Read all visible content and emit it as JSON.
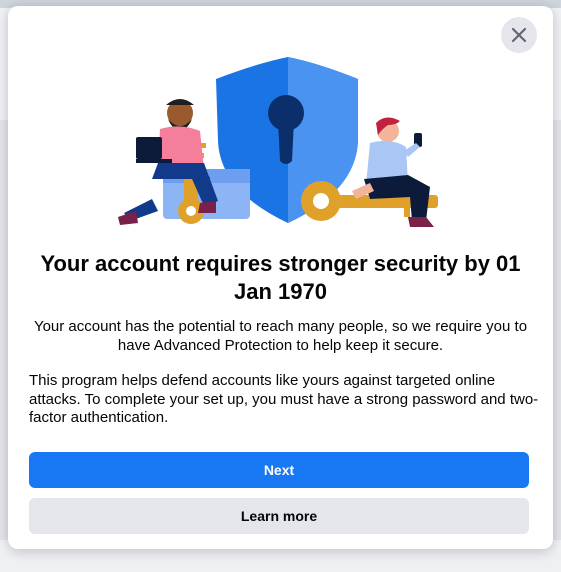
{
  "dialog": {
    "title": "Your account requires stronger security by 01 Jan 1970",
    "subtitle": "Your account has the potential to reach many people, so we require you to have Advanced Protection to help keep it secure.",
    "body": "This program helps defend accounts like yours against targeted online attacks. To complete your set up, you must have a strong password and two-factor authentication.",
    "primary_button": "Next",
    "secondary_button": "Learn more",
    "close_icon": "close-icon",
    "illustration": "shield-keyhole-with-people-and-keys"
  },
  "colors": {
    "primary": "#1877f2",
    "secondary_bg": "#e4e6eb",
    "text": "#050505",
    "shield": "#1b74e4",
    "key": "#e0a12b"
  }
}
